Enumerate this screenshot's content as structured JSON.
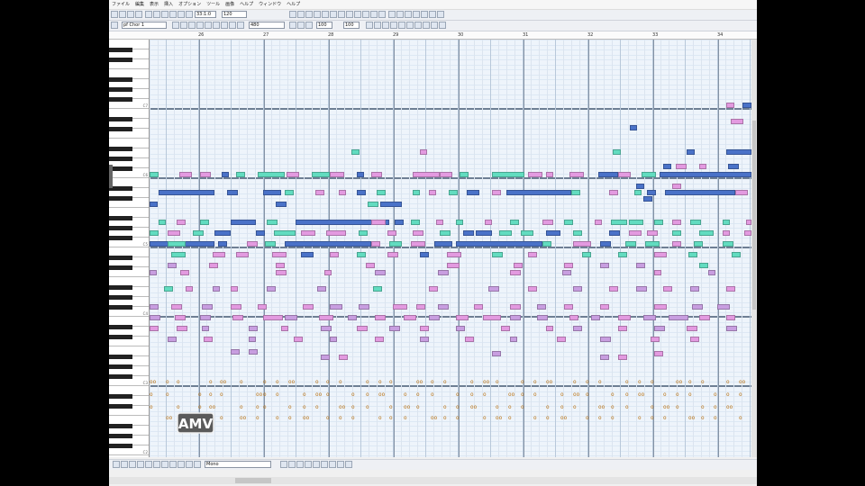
{
  "menu": [
    "ファイル",
    "編集",
    "表示",
    "挿入",
    "オプション",
    "ツール",
    "画像",
    "ヘルプ",
    "ウィンドウ",
    "ヘルプ"
  ],
  "toolbar": {
    "timebase": "480",
    "tempo": "120",
    "position": "33:1:0",
    "track_name": "pf Chor 1",
    "velocity": "100",
    "gate": "100",
    "channel": "Mono"
  },
  "ruler": {
    "bars": [
      "26",
      "27",
      "28",
      "29",
      "30",
      "31",
      "32",
      "33",
      "34"
    ]
  },
  "keyboard": {
    "octave_labels": [
      "C7",
      "C6",
      "C5",
      "C4",
      "C3",
      "C2"
    ]
  },
  "logo_text": "AMV",
  "bottom": {
    "mode_label": "Mono"
  },
  "colors": {
    "blue": "#4a72c8",
    "pink": "#e39ae0",
    "teal": "#62dcc0",
    "lavender": "#c89ee0",
    "velocity": "#c88820",
    "roll_bg": "#eef4fb"
  },
  "rows_glyphs": {
    "vel_a": "o",
    "vel_b": "oo"
  }
}
